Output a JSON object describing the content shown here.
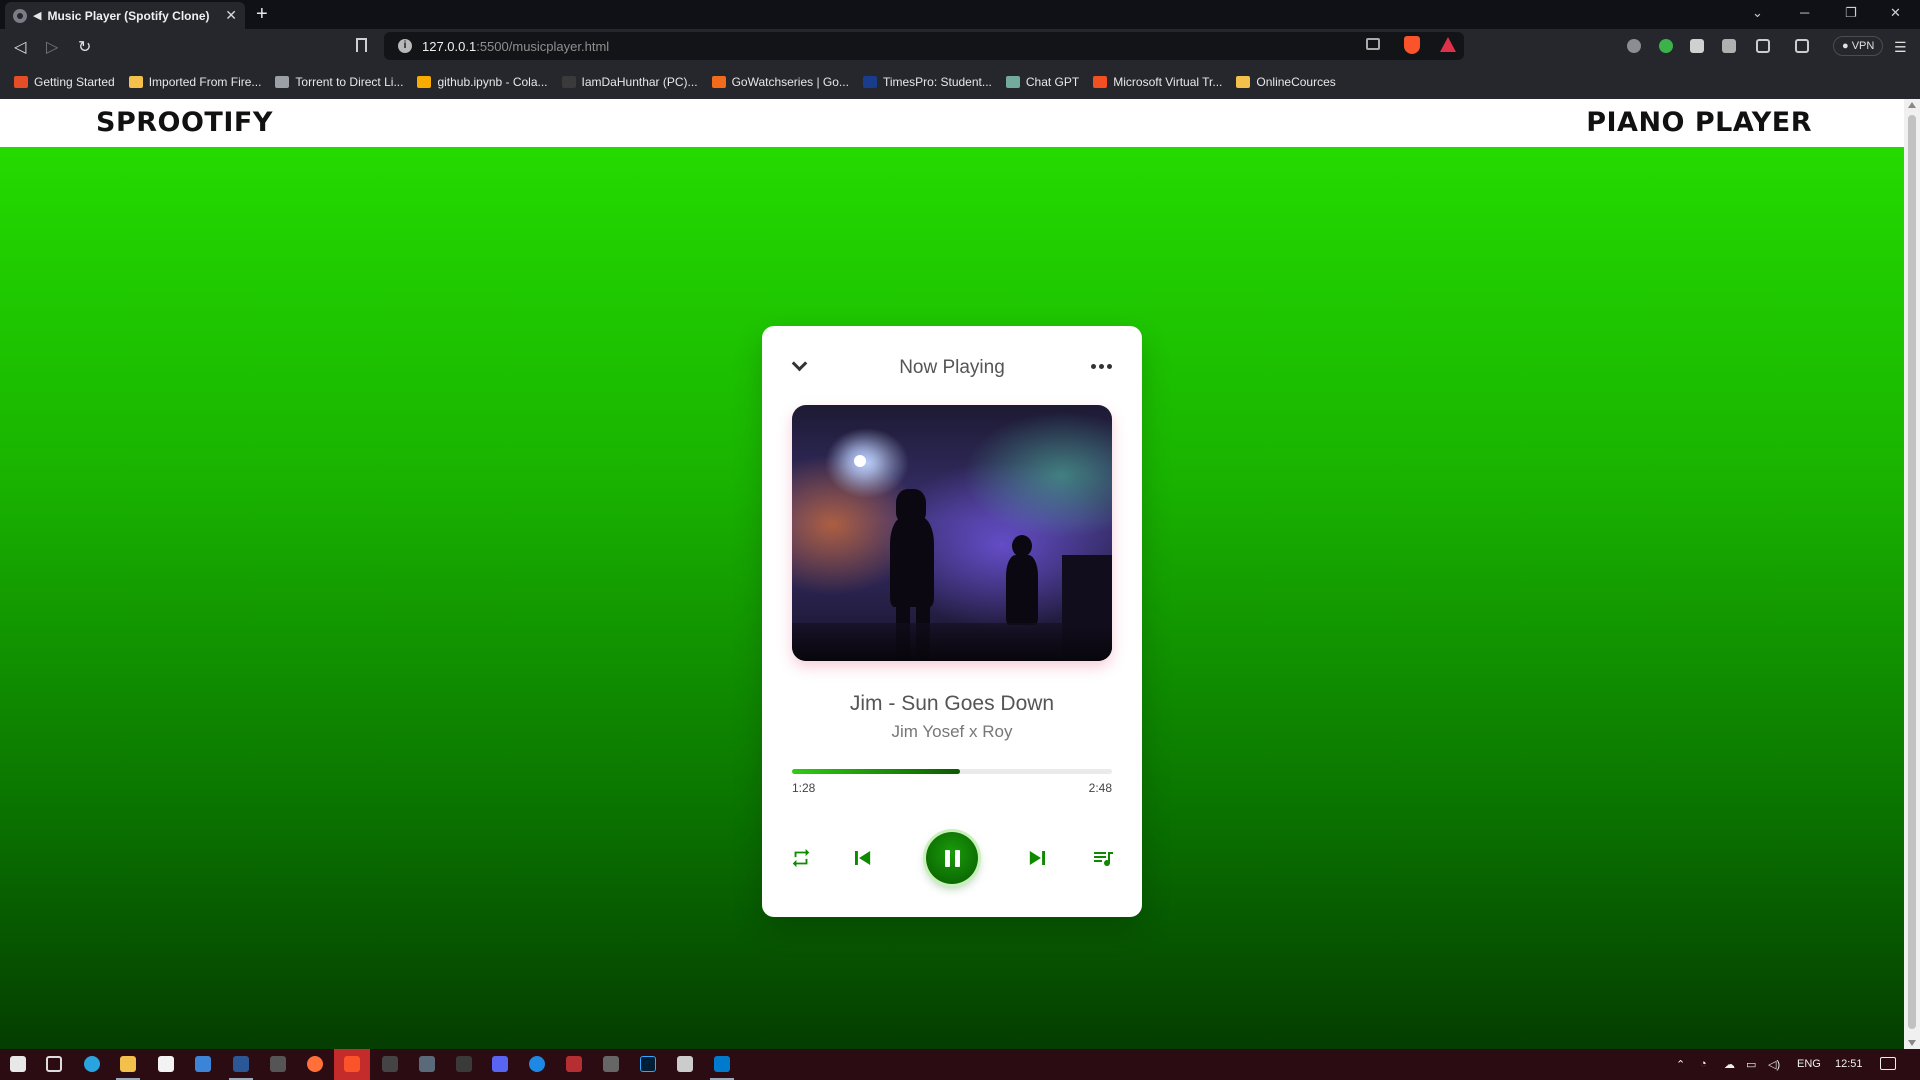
{
  "browser": {
    "tab_title": "Music Player (Spotify Clone)",
    "tab_close": "✕",
    "new_tab": "+",
    "url_host": "127.0.0.1",
    "url_path": ":5500/musicplayer.html",
    "vpn_label": "VPN"
  },
  "bookmarks": [
    {
      "label": "Getting Started",
      "color": "#e44d26"
    },
    {
      "label": "Imported From Fire...",
      "color": "#f2c04b"
    },
    {
      "label": "Torrent to Direct Li...",
      "color": "#9aa0a6"
    },
    {
      "label": "github.ipynb - Cola...",
      "color": "#f9ab00"
    },
    {
      "label": "IamDaHunthar (PC)...",
      "color": "#3a3a3a"
    },
    {
      "label": "GoWatchseries | Go...",
      "color": "#f26b1d"
    },
    {
      "label": "TimesPro: Student...",
      "color": "#1a3c8c"
    },
    {
      "label": "Chat GPT",
      "color": "#74aa9c"
    },
    {
      "label": "Microsoft Virtual Tr...",
      "color": "#f25022"
    },
    {
      "label": "OnlineCources",
      "color": "#f2c04b"
    }
  ],
  "site": {
    "brand": "SPROOTIFY",
    "nav_right": "PIANO PLAYER"
  },
  "player": {
    "header": "Now Playing",
    "song_title": "Jim - Sun Goes Down",
    "artist": "Jim Yosef x Roy",
    "current_time": "1:28",
    "total_time": "2:48",
    "progress_fraction": 0.525,
    "accent_color": "#0f8a00"
  },
  "taskbar": {
    "language": "ENG",
    "clock": "12:51"
  },
  "colors": {
    "page_gradient_top": "#26e000",
    "page_gradient_bottom": "#043d00",
    "taskbar_bg": "#2a0c12"
  }
}
